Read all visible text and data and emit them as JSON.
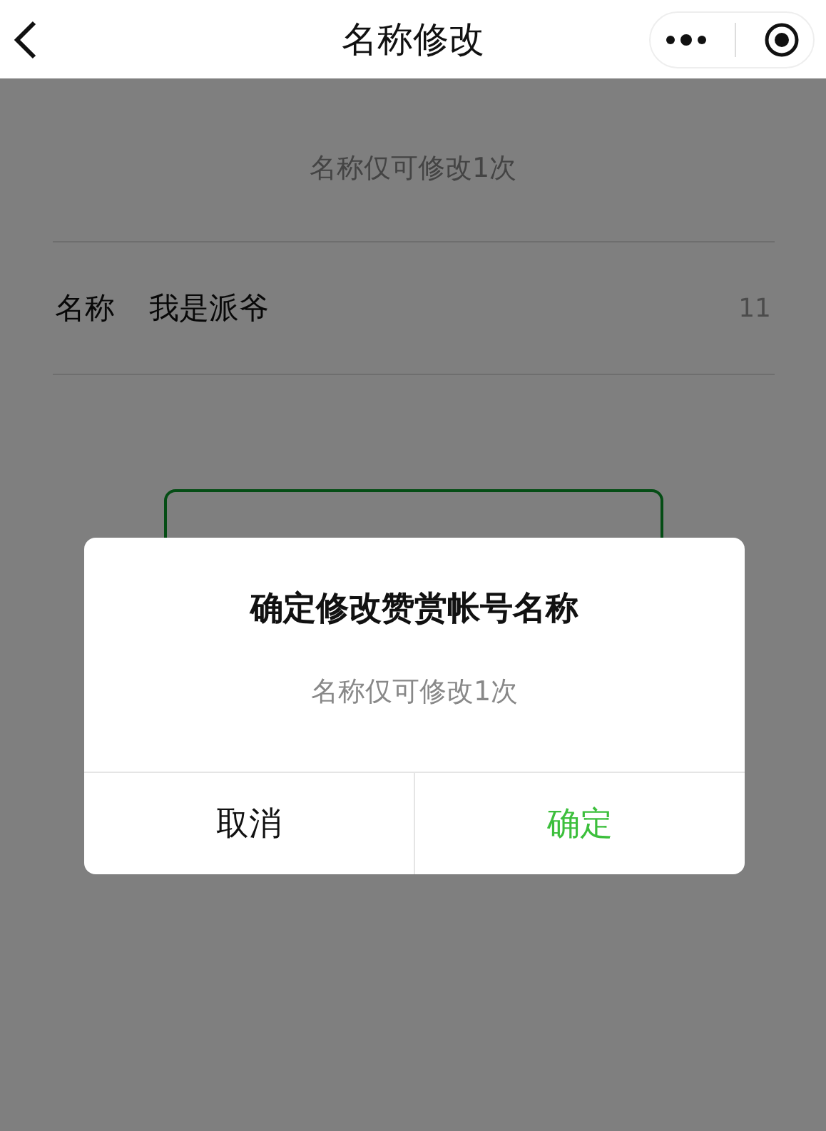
{
  "nav": {
    "title": "名称修改"
  },
  "hint": "名称仅可修改1次",
  "field": {
    "label": "名称",
    "value": "我是派爷",
    "count": "11"
  },
  "dialog": {
    "title": "确定修改赞赏帐号名称",
    "message": "名称仅可修改1次",
    "buttons": [
      {
        "label": "取消",
        "kind": "cancel"
      },
      {
        "label": "确定",
        "kind": "confirm"
      }
    ]
  }
}
